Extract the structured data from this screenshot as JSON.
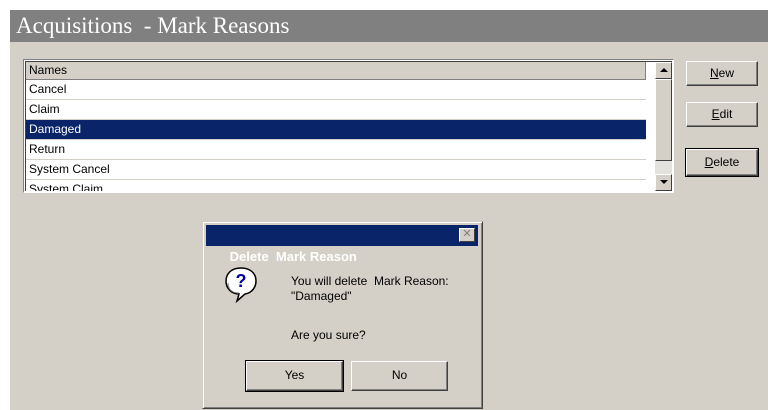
{
  "window": {
    "title": "Acquisitions  - Mark Reasons"
  },
  "list": {
    "header": "Names",
    "items": [
      {
        "label": "Cancel",
        "selected": false
      },
      {
        "label": "Claim",
        "selected": false
      },
      {
        "label": "Damaged",
        "selected": true
      },
      {
        "label": "Return",
        "selected": false
      },
      {
        "label": "System Cancel",
        "selected": false
      },
      {
        "label": "System Claim",
        "selected": false
      }
    ]
  },
  "buttons": {
    "new_mnemonic": "N",
    "new_rest": "ew",
    "edit_mnemonic": "E",
    "edit_rest": "dit",
    "delete_mnemonic": "D",
    "delete_rest": "elete"
  },
  "dialog": {
    "title": "Delete  Mark Reason",
    "icon": "question-icon",
    "message_line1": "You will delete  Mark Reason:",
    "message_line2": "\"Damaged\"",
    "confirm": "Are you sure?",
    "yes_label": "Yes",
    "no_label": "No",
    "close_glyph": "✕"
  },
  "colors": {
    "selection": "#0a246a",
    "window_bg": "#d4d0c8",
    "titlebar_bg": "#808080"
  }
}
